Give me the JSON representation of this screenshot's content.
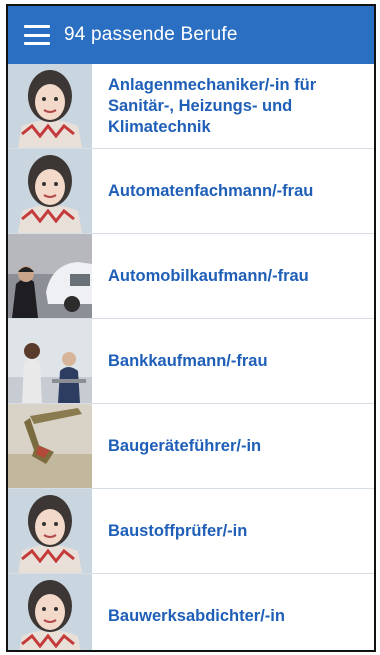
{
  "header": {
    "title": "94 passende Berufe",
    "menu_icon": "hamburger-menu-icon"
  },
  "colors": {
    "header_bg": "#2b6fc3",
    "label_text": "#1f5fb8",
    "divider": "#d7dde5"
  },
  "jobs": [
    {
      "label": "Anlagenmechaniker/-in für Sanitär-, Heizungs- und Klimatechnik",
      "thumb": "illustrated-girl"
    },
    {
      "label": "Automatenfachmann/-frau",
      "thumb": "illustrated-girl"
    },
    {
      "label": "Automobilkaufmann/-frau",
      "thumb": "car-dealer-photo"
    },
    {
      "label": "Bankkaufmann/-frau",
      "thumb": "bank-counter-photo"
    },
    {
      "label": "Baugeräteführer/-in",
      "thumb": "excavator-photo"
    },
    {
      "label": "Baustoffprüfer/-in",
      "thumb": "illustrated-girl"
    },
    {
      "label": "Bauwerksabdichter/-in",
      "thumb": "illustrated-girl"
    }
  ]
}
